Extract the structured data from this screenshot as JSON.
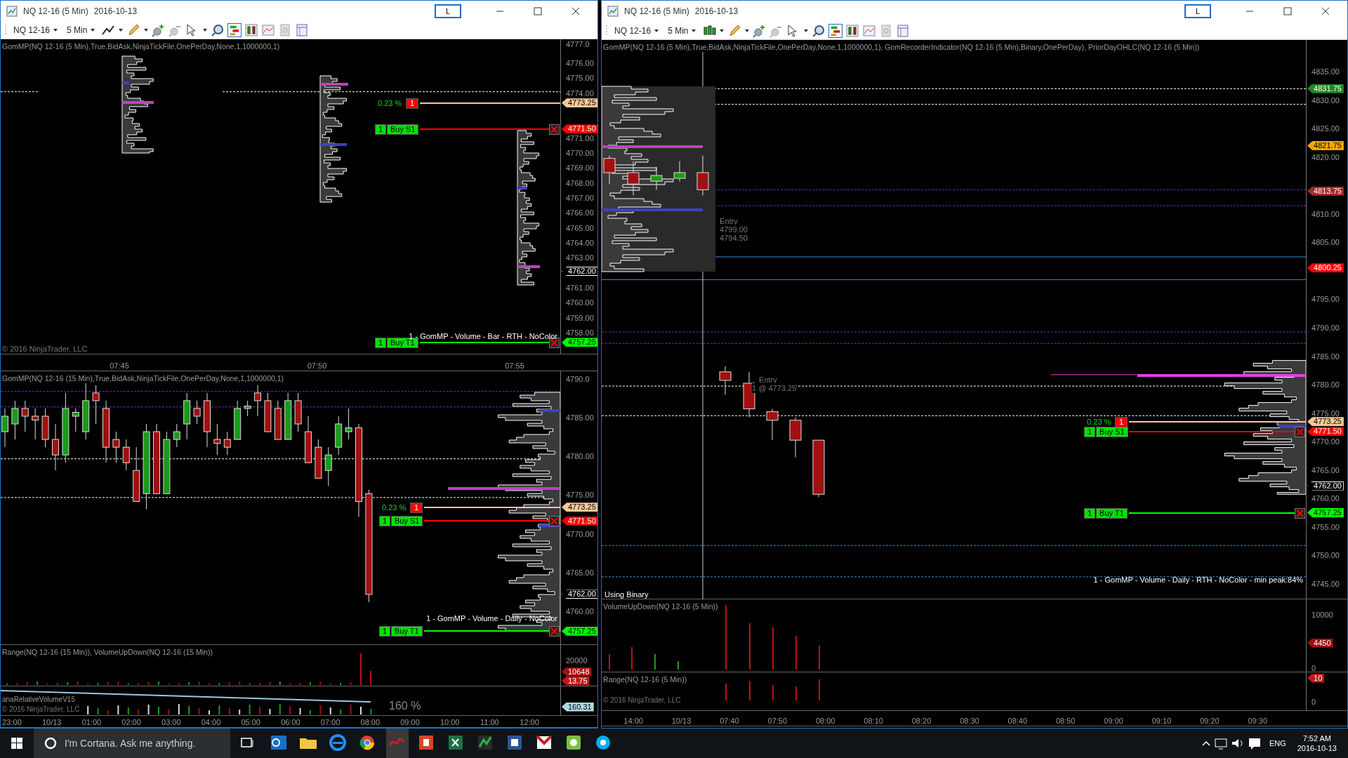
{
  "windows": [
    {
      "title": "NQ 12-16 (5 Min)",
      "date": "2016-10-13",
      "link_button": "L",
      "instrument": "NQ 12-16",
      "interval": "5 Min",
      "panels": [
        {
          "label": "GomMP(NQ 12-16 (5 Min),True,BidAsk,NinjaTickFile,OnePerDay,None,1,1000000,1)",
          "ticks": [
            "4777.0",
            "4776.00",
            "4775.00",
            "4774.00",
            "4771.00",
            "4770.00",
            "4769.00",
            "4768.00",
            "4767.00",
            "4766.00",
            "4765.00",
            "4764.00",
            "4763.00",
            "4761.00",
            "4760.00",
            "4759.00",
            "4758.00"
          ],
          "price_tags": [
            {
              "value": "4773.25",
              "color": "#f5c896",
              "order": {
                "kind": "pending",
                "percent": "0.23 %",
                "qty": "1"
              }
            },
            {
              "value": "4771.50",
              "color": "#ff0000",
              "order": {
                "kind": "stop",
                "qty": "1",
                "name": "Buy S1"
              }
            },
            {
              "value": "4762.00",
              "color": "#000000"
            },
            {
              "value": "4757.25",
              "color": "#00ff00",
              "order": {
                "kind": "target",
                "qty": "1",
                "name": "Buy T1"
              }
            }
          ],
          "notes": [
            "1 - GomMP  - Volume - Bar - RTH - NoColor",
            "© 2016 NinjaTrader, LLC"
          ],
          "time_labels": [
            "07:45",
            "07:50",
            "07:55"
          ]
        },
        {
          "label": "GomMP(NQ 12-16 (15 Min),True,BidAsk,NinjaTickFile,OnePerDay,None,1,1000000,1)",
          "ticks": [
            "4790.0",
            "4785.00",
            "4780.00",
            "4775.00",
            "4770.00",
            "4765.00",
            "4760.00"
          ],
          "price_tags": [
            {
              "value": "4773.25",
              "color": "#f5c896",
              "order": {
                "kind": "pending",
                "percent": "0.23 %",
                "qty": "1"
              }
            },
            {
              "value": "4771.50",
              "color": "#ff0000",
              "order": {
                "kind": "stop",
                "qty": "1",
                "name": "Buy S1"
              }
            },
            {
              "value": "4762.00",
              "color": "#000000"
            },
            {
              "value": "4757.25",
              "color": "#00ff00",
              "order": {
                "kind": "target",
                "qty": "1",
                "name": "Buy T1"
              }
            }
          ],
          "notes": [
            "1 - GomMP - Volume - Daily - NoColor"
          ]
        },
        {
          "label": "Range(NQ 12-16 (15 Min)), VolumeUpDown(NQ 12-16 (15 Min))",
          "ticks": [
            "20000"
          ],
          "price_tags": [
            {
              "value": "10648",
              "color": "#a01010"
            },
            {
              "value": "13.75",
              "color": "#c01818"
            }
          ]
        },
        {
          "label": "anaRelativeVolumeV15",
          "price_tags": [
            {
              "value": "160.31",
              "color": "#add8e6"
            }
          ],
          "notes": [
            "© 2016 NinjaTrader, LLC",
            "160 %"
          ],
          "time_labels": [
            "23:00",
            "10/13",
            "01:00",
            "02:00",
            "03:00",
            "04:00",
            "05:00",
            "06:00",
            "07:00",
            "08:00",
            "09:00",
            "10:00",
            "11:00",
            "12:00"
          ]
        }
      ]
    },
    {
      "title": "NQ 12-16 (5 Min)",
      "date": "2016-10-13",
      "link_button": "L",
      "instrument": "NQ 12-16",
      "interval": "5 Min",
      "panels": [
        {
          "label": "GomMP(NQ 12-16 (5 Min),True,BidAsk,NinjaTickFile,OnePerDay,None,1,1000000,1), GomRecorderIndicator(NQ 12-16 (5 Min),Binary,OnePerDay), PriorDayOHLC(NQ 12-16 (5 Min))",
          "ticks": [
            "4835.00",
            "4830.00",
            "4825.00",
            "4820.00",
            "4810.00",
            "4805.00",
            "4795.00",
            "4790.00",
            "4785.00",
            "4780.00",
            "4775.00",
            "4770.00",
            "4765.00",
            "4760.00",
            "4755.00",
            "4750.00",
            "4745.00"
          ],
          "price_tags": [
            {
              "value": "4831.75",
              "color": "#1f8a1f"
            },
            {
              "value": "4821.75",
              "color": "#ffa500"
            },
            {
              "value": "4813.75",
              "color": "#a52a2a"
            },
            {
              "value": "4800.25",
              "color": "#ff0000"
            },
            {
              "value": "4773.25",
              "color": "#f5c896",
              "order": {
                "kind": "pending",
                "percent": "0.23 %",
                "qty": "1"
              }
            },
            {
              "value": "4771.50",
              "color": "#ff0000",
              "order": {
                "kind": "stop",
                "qty": "1",
                "name": "Buy S1"
              }
            },
            {
              "value": "4762.00",
              "color": "#000000"
            },
            {
              "value": "4757.25",
              "color": "#00ff00",
              "order": {
                "kind": "target",
                "qty": "1",
                "name": "Buy T1"
              }
            }
          ],
          "notes": [
            "Entry",
            "4799.00",
            "4794.50",
            "Entry",
            "1 @ 4773.25",
            "Using Binary",
            "1 - GomMP  - Volume - Daily - RTH - NoColor - min peak:84%"
          ]
        },
        {
          "label": "VolumeUpDown(NQ 12-16 (5 Min))",
          "ticks": [
            "10000",
            "0"
          ],
          "price_tags": [
            {
              "value": "4450",
              "color": "#a01010"
            }
          ]
        },
        {
          "label": "Range(NQ 12-16 (5 Min))",
          "ticks": [
            "0"
          ],
          "price_tags": [
            {
              "value": "10",
              "color": "#c01818"
            }
          ],
          "notes": [
            "© 2016 NinjaTrader, LLC"
          ],
          "time_labels": [
            "14:00",
            "10/13",
            "07:40",
            "07:50",
            "08:00",
            "08:10",
            "08:20",
            "08:30",
            "08:40",
            "08:50",
            "09:00",
            "09:10",
            "09:20",
            "09:30"
          ]
        }
      ]
    }
  ],
  "taskbar": {
    "search_placeholder": "I'm Cortana. Ask me anything.",
    "language": "ENG",
    "time": "7:52 AM",
    "date": "2016-10-13"
  }
}
